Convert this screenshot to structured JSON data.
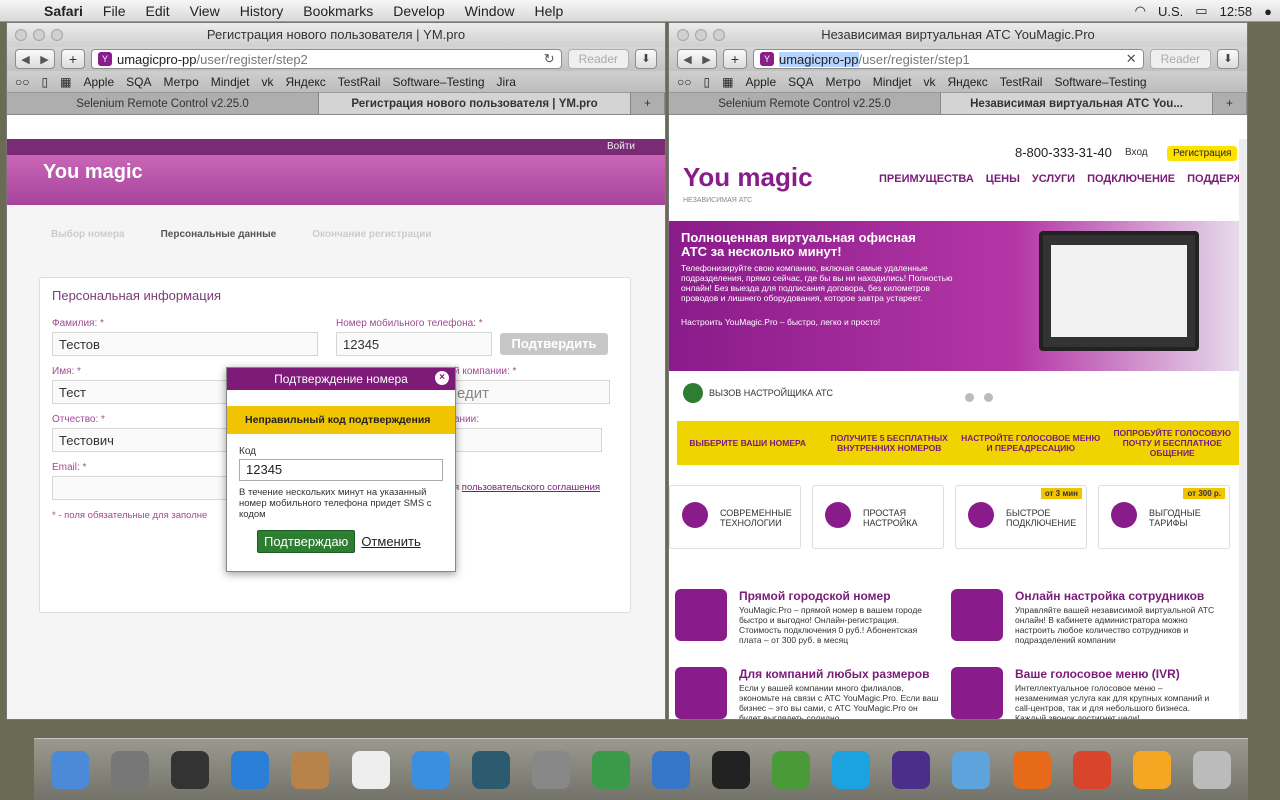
{
  "menubar": {
    "app": "Safari",
    "items": [
      "File",
      "Edit",
      "View",
      "History",
      "Bookmarks",
      "Develop",
      "Window",
      "Help"
    ],
    "lang": "U.S.",
    "time": "12:58"
  },
  "left": {
    "title": "Регистрация нового пользователя | YM.pro",
    "url_host": "umagicpro-pp",
    "url_path": "/user/register/step2",
    "reader": "Reader",
    "bookmarks": [
      "Apple",
      "SQA",
      "Метро",
      "Mindjet",
      "vk",
      "Яндекс",
      "TestRail",
      "Software–Testing",
      "Jira"
    ],
    "tabs": [
      "Selenium Remote Control v2.25.0",
      "Регистрация нового пользователя | YM.pro"
    ],
    "page": {
      "topnav": "Войти",
      "logo": "You magic",
      "steps": [
        "Выбор номера",
        "Персональные данные",
        "Окончание регистрации"
      ],
      "card_title": "Персональная информация",
      "l_last": "Фамилия: *",
      "v_last": "Тестов",
      "l_first": "Имя: *",
      "v_first": "Тест",
      "l_middle": "Отчество: *",
      "v_middle": "Тестович",
      "l_email": "Email: *",
      "l_phone": "Номер мобильного телефона: *",
      "v_phone": "12345",
      "confirm": "Подтвердить",
      "l_company": "й компании: *",
      "v_company": "едит",
      "l_co2": "ании:",
      "agree_pre": "я ",
      "agree_link": "пользовательского соглашения",
      "req_note": "* - поля обязательные для заполне"
    },
    "modal": {
      "title": "Подтверждение номера",
      "warning": "Неправильный код подтверждения",
      "code_label": "Код",
      "code": "12345",
      "text": "В течение нескольких минут на указанный номер мобильного телефона придет SMS с кодом",
      "ok": "Подтверждаю",
      "cancel": "Отменить"
    }
  },
  "right": {
    "title": "Независимая виртуальная АТС YouMagic.Pro",
    "url_host": "umagicpro-pp",
    "url_path": "/user/register/step1",
    "reader": "Reader",
    "bookmarks": [
      "Apple",
      "SQA",
      "Метро",
      "Mindjet",
      "vk",
      "Яндекс",
      "TestRail",
      "Software–Testing"
    ],
    "tabs": [
      "Selenium Remote Control v2.25.0",
      "Независимая виртуальная АТС You..."
    ],
    "page": {
      "phone": "8-800-333-31-40",
      "login": "Вход",
      "register": "Регистрация",
      "logo": "You magic",
      "logo_sub": "НЕЗАВИСИМАЯ АТС",
      "nav": [
        "ПРЕИМУЩЕСТВА",
        "ЦЕНЫ",
        "УСЛУГИ",
        "ПОДКЛЮЧЕНИЕ",
        "ПОДДЕРЖКА"
      ],
      "hero_title": "Полноценная виртуальная офисная АТС за несколько минут!",
      "hero_text": "Телефонизируйте свою компанию, включая самые удаленные подразделения, прямо сейчас, где бы вы ни находились! Полностью онлайн! Без выезда для подписания договора, без километров проводов и лишнего оборудования, которое завтра устареет.",
      "hero_sub": "Настроить YouMagic.Pro – быстро, легко и просто!",
      "call": "ВЫЗОВ НАСТРОЙЩИКА АТС",
      "steps": [
        "ВЫБЕРИТЕ ВАШИ НОМЕРА",
        "ПОЛУЧИТЕ 5 БЕСПЛАТНЫХ ВНУТРЕННИХ НОМЕРОВ",
        "НАСТРОЙТЕ ГОЛОСОВОЕ МЕНЮ И ПЕРЕАДРЕСАЦИЮ",
        "ПОПРОБУЙТЕ ГОЛОСОВУЮ ПОЧТУ И БЕСПЛАТНОЕ ОБЩЕНИЕ"
      ],
      "features": [
        {
          "t": "СОВРЕМЕННЫЕ ТЕХНОЛОГИИ",
          "b": ""
        },
        {
          "t": "ПРОСТАЯ НАСТРОЙКА",
          "b": ""
        },
        {
          "t": "БЫСТРОЕ ПОДКЛЮЧЕНИЕ",
          "b": "от 3 мин"
        },
        {
          "t": "ВЫГОДНЫЕ ТАРИФЫ",
          "b": "от 300 р."
        }
      ],
      "services": [
        {
          "h": "Прямой городской номер",
          "p": "YouMagic.Pro – прямой номер в вашем городе быстро и выгодно! Онлайн-регистрация. Стоимость подключения 0 руб.! Абонентская плата – от 300 руб. в месяц"
        },
        {
          "h": "Онлайн настройка сотрудников",
          "p": "Управляйте вашей независимой виртуальной АТС онлайн! В кабинете администратора можно настроить любое количество сотрудников и подразделений компании"
        },
        {
          "h": "Для компаний любых размеров",
          "p": "Если у вашей компании много филиалов, экономьте на связи с АТС YouMagic.Pro. Если ваш бизнес – это вы сами, с АТС YouMagic.Pro он будет выглядеть солидно"
        },
        {
          "h": "Ваше голосовое меню (IVR)",
          "p": "Интеллектуальное голосовое меню – незаменимая услуга как для крупных компаний и call-центров, так и для небольшого бизнеса. Каждый звонок достигнет цели!"
        }
      ]
    }
  }
}
